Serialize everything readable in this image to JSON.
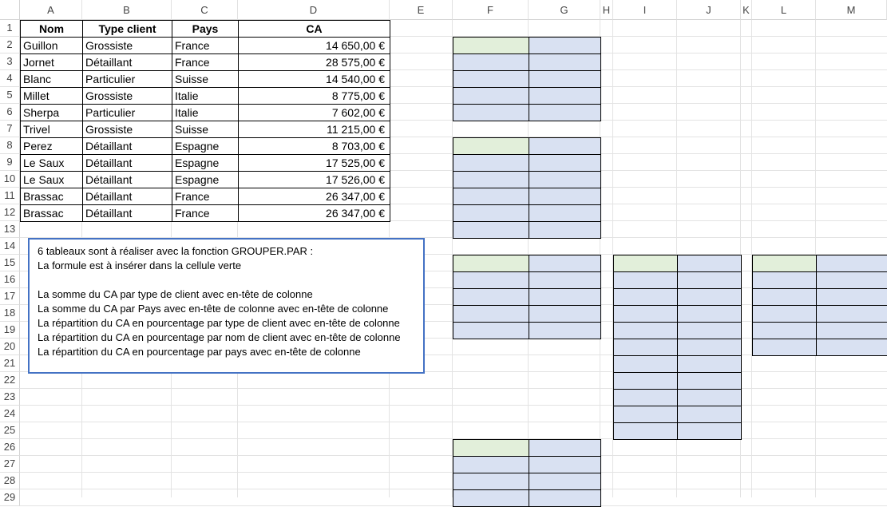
{
  "columns": [
    "A",
    "B",
    "C",
    "D",
    "E",
    "F",
    "G",
    "H",
    "I",
    "J",
    "K",
    "L",
    "M"
  ],
  "rows": [
    "1",
    "2",
    "3",
    "4",
    "5",
    "6",
    "7",
    "8",
    "9",
    "10",
    "11",
    "12",
    "13",
    "14",
    "15",
    "16",
    "17",
    "18",
    "19",
    "20",
    "21",
    "22",
    "23",
    "24",
    "25",
    "26",
    "27",
    "28",
    "29"
  ],
  "table": {
    "headers": [
      "Nom",
      "Type client",
      "Pays",
      "CA"
    ],
    "rows": [
      [
        "Guillon",
        "Grossiste",
        "France",
        "14 650,00 €"
      ],
      [
        "Jornet",
        "Détaillant",
        "France",
        "28 575,00 €"
      ],
      [
        "Blanc",
        "Particulier",
        "Suisse",
        "14 540,00 €"
      ],
      [
        "Millet",
        "Grossiste",
        "Italie",
        "8 775,00 €"
      ],
      [
        "Sherpa",
        "Particulier",
        "Italie",
        "7 602,00 €"
      ],
      [
        "Trivel",
        "Grossiste",
        "Suisse",
        "11 215,00 €"
      ],
      [
        "Perez",
        "Détaillant",
        "Espagne",
        "8 703,00 €"
      ],
      [
        "Le Saux",
        "Détaillant",
        "Espagne",
        "17 525,00 €"
      ],
      [
        "Le Saux",
        "Détaillant",
        "Espagne",
        "17 526,00 €"
      ],
      [
        "Brassac",
        "Détaillant",
        "France",
        "26 347,00 €"
      ],
      [
        "Brassac",
        "Détaillant",
        "France",
        "26 347,00 €"
      ]
    ]
  },
  "note": {
    "lines": [
      "6 tableaux sont à réaliser avec la fonction GROUPER.PAR :",
      "La formule est à insérer dans la cellule verte",
      "",
      "La somme du CA par type de client avec en-tête de colonne",
      "La somme du CA par Pays avec en-tête de colonne avec en-tête de colonne",
      "La répartition du CA en pourcentage par type de client avec en-tête de colonne",
      "La répartition du CA en pourcentage par nom de client avec en-tête de colonne",
      "La répartition du CA en pourcentage par pays avec en-tête de colonne"
    ]
  },
  "colors": {
    "answer_cell": "#e2efda",
    "result_cell": "#d9e1f2",
    "note_border": "#4472c4"
  }
}
